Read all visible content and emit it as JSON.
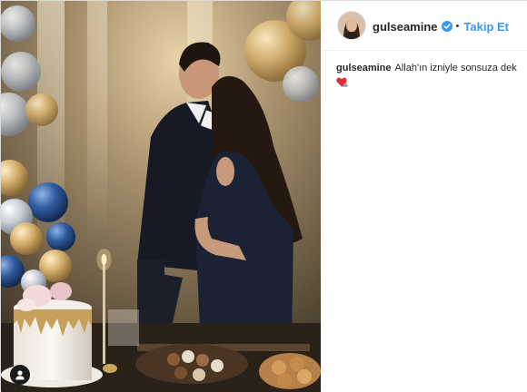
{
  "post": {
    "username": "gulseamine",
    "follow_label": "Takip Et",
    "separator": "•",
    "caption_username": "gulseamine",
    "caption_text": "Allah'ın izniyle sonsuza dek",
    "caption_emojis": [
      "folded-hands-icon",
      "red-heart-icon"
    ],
    "verified": true
  },
  "colors": {
    "accent": "#3897f0",
    "text": "#262626",
    "heart": "#e02a3e",
    "verified_badge": "#3897f0"
  }
}
